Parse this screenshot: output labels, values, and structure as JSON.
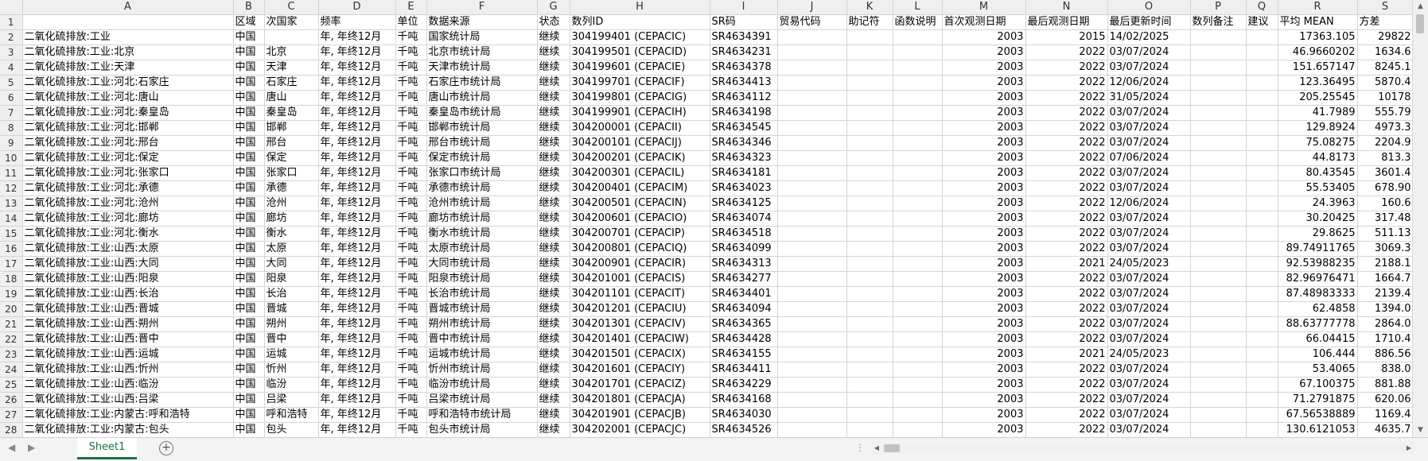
{
  "columns": [
    "A",
    "B",
    "C",
    "D",
    "E",
    "F",
    "G",
    "H",
    "I",
    "J",
    "K",
    "L",
    "M",
    "N",
    "O",
    "P",
    "Q",
    "R",
    "S"
  ],
  "header_row": {
    "rownum": "1",
    "cells": [
      "",
      "区域",
      "次国家",
      "频率",
      "单位",
      "数据来源",
      "状态",
      "数列ID",
      "SR码",
      "贸易代码",
      "助记符",
      "函数说明",
      "首次观测日期",
      "最后观测日期",
      "最后更新时间",
      "数列备注",
      "建议",
      "平均 MEAN",
      "方差"
    ]
  },
  "rows": [
    {
      "n": "2",
      "a": "二氧化硫排放:工业",
      "b": "中国",
      "c": "",
      "d": "年, 年终12月",
      "e": "千吨",
      "f": "国家统计局",
      "g": "继续",
      "h": "304199401 (CEPACIC)",
      "i": "SR4634391",
      "m": "2003",
      "nn": "2015",
      "o": "14/02/2025",
      "r": "17363.105",
      "s": "29822"
    },
    {
      "n": "3",
      "a": "二氧化硫排放:工业:北京",
      "b": "中国",
      "c": "北京",
      "d": "年, 年终12月",
      "e": "千吨",
      "f": "北京市统计局",
      "g": "继续",
      "h": "304199501 (CEPACID)",
      "i": "SR4634231",
      "m": "2003",
      "nn": "2022",
      "o": "03/07/2024",
      "r": "46.9660202",
      "s": "1634.6"
    },
    {
      "n": "4",
      "a": "二氧化硫排放:工业:天津",
      "b": "中国",
      "c": "天津",
      "d": "年, 年终12月",
      "e": "千吨",
      "f": "天津市统计局",
      "g": "继续",
      "h": "304199601 (CEPACIE)",
      "i": "SR4634378",
      "m": "2003",
      "nn": "2022",
      "o": "03/07/2024",
      "r": "151.657147",
      "s": "8245.1"
    },
    {
      "n": "5",
      "a": "二氧化硫排放:工业:河北:石家庄",
      "b": "中国",
      "c": "石家庄",
      "d": "年, 年终12月",
      "e": "千吨",
      "f": "石家庄市统计局",
      "g": "继续",
      "h": "304199701 (CEPACIF)",
      "i": "SR4634413",
      "m": "2003",
      "nn": "2022",
      "o": "12/06/2024",
      "r": "123.36495",
      "s": "5870.4"
    },
    {
      "n": "6",
      "a": "二氧化硫排放:工业:河北:唐山",
      "b": "中国",
      "c": "唐山",
      "d": "年, 年终12月",
      "e": "千吨",
      "f": "唐山市统计局",
      "g": "继续",
      "h": "304199801 (CEPACIG)",
      "i": "SR4634112",
      "m": "2003",
      "nn": "2022",
      "o": "31/05/2024",
      "r": "205.25545",
      "s": "10178"
    },
    {
      "n": "7",
      "a": "二氧化硫排放:工业:河北:秦皇岛",
      "b": "中国",
      "c": "秦皇岛",
      "d": "年, 年终12月",
      "e": "千吨",
      "f": "秦皇岛市统计局",
      "g": "继续",
      "h": "304199901 (CEPACIH)",
      "i": "SR4634198",
      "m": "2003",
      "nn": "2022",
      "o": "03/07/2024",
      "r": "41.7989",
      "s": "555.79"
    },
    {
      "n": "8",
      "a": "二氧化硫排放:工业:河北:邯郸",
      "b": "中国",
      "c": "邯郸",
      "d": "年, 年终12月",
      "e": "千吨",
      "f": "邯郸市统计局",
      "g": "继续",
      "h": "304200001 (CEPACII)",
      "i": "SR4634545",
      "m": "2003",
      "nn": "2022",
      "o": "03/07/2024",
      "r": "129.8924",
      "s": "4973.3"
    },
    {
      "n": "9",
      "a": "二氧化硫排放:工业:河北:邢台",
      "b": "中国",
      "c": "邢台",
      "d": "年, 年终12月",
      "e": "千吨",
      "f": "邢台市统计局",
      "g": "继续",
      "h": "304200101 (CEPACIJ)",
      "i": "SR4634346",
      "m": "2003",
      "nn": "2022",
      "o": "03/07/2024",
      "r": "75.08275",
      "s": "2204.9"
    },
    {
      "n": "10",
      "a": "二氧化硫排放:工业:河北:保定",
      "b": "中国",
      "c": "保定",
      "d": "年, 年终12月",
      "e": "千吨",
      "f": "保定市统计局",
      "g": "继续",
      "h": "304200201 (CEPACIK)",
      "i": "SR4634323",
      "m": "2003",
      "nn": "2022",
      "o": "07/06/2024",
      "r": "44.8173",
      "s": "813.3"
    },
    {
      "n": "11",
      "a": "二氧化硫排放:工业:河北:张家口",
      "b": "中国",
      "c": "张家口",
      "d": "年, 年终12月",
      "e": "千吨",
      "f": "张家口市统计局",
      "g": "继续",
      "h": "304200301 (CEPACIL)",
      "i": "SR4634181",
      "m": "2003",
      "nn": "2022",
      "o": "03/07/2024",
      "r": "80.43545",
      "s": "3601.4"
    },
    {
      "n": "12",
      "a": "二氧化硫排放:工业:河北:承德",
      "b": "中国",
      "c": "承德",
      "d": "年, 年终12月",
      "e": "千吨",
      "f": "承德市统计局",
      "g": "继续",
      "h": "304200401 (CEPACIM)",
      "i": "SR4634023",
      "m": "2003",
      "nn": "2022",
      "o": "03/07/2024",
      "r": "55.53405",
      "s": "678.90"
    },
    {
      "n": "13",
      "a": "二氧化硫排放:工业:河北:沧州",
      "b": "中国",
      "c": "沧州",
      "d": "年, 年终12月",
      "e": "千吨",
      "f": "沧州市统计局",
      "g": "继续",
      "h": "304200501 (CEPACIN)",
      "i": "SR4634125",
      "m": "2003",
      "nn": "2022",
      "o": "12/06/2024",
      "r": "24.3963",
      "s": "160.6"
    },
    {
      "n": "14",
      "a": "二氧化硫排放:工业:河北:廊坊",
      "b": "中国",
      "c": "廊坊",
      "d": "年, 年终12月",
      "e": "千吨",
      "f": "廊坊市统计局",
      "g": "继续",
      "h": "304200601 (CEPACIO)",
      "i": "SR4634074",
      "m": "2003",
      "nn": "2022",
      "o": "03/07/2024",
      "r": "30.20425",
      "s": "317.48"
    },
    {
      "n": "15",
      "a": "二氧化硫排放:工业:河北:衡水",
      "b": "中国",
      "c": "衡水",
      "d": "年, 年终12月",
      "e": "千吨",
      "f": "衡水市统计局",
      "g": "继续",
      "h": "304200701 (CEPACIP)",
      "i": "SR4634518",
      "m": "2003",
      "nn": "2022",
      "o": "03/07/2024",
      "r": "29.8625",
      "s": "511.13"
    },
    {
      "n": "16",
      "a": "二氧化硫排放:工业:山西:太原",
      "b": "中国",
      "c": "太原",
      "d": "年, 年终12月",
      "e": "千吨",
      "f": "太原市统计局",
      "g": "继续",
      "h": "304200801 (CEPACIQ)",
      "i": "SR4634099",
      "m": "2003",
      "nn": "2022",
      "o": "03/07/2024",
      "r": "89.74911765",
      "s": "3069.3"
    },
    {
      "n": "17",
      "a": "二氧化硫排放:工业:山西:大同",
      "b": "中国",
      "c": "大同",
      "d": "年, 年终12月",
      "e": "千吨",
      "f": "大同市统计局",
      "g": "继续",
      "h": "304200901 (CEPACIR)",
      "i": "SR4634313",
      "m": "2003",
      "nn": "2021",
      "o": "24/05/2023",
      "r": "92.53988235",
      "s": "2188.1"
    },
    {
      "n": "18",
      "a": "二氧化硫排放:工业:山西:阳泉",
      "b": "中国",
      "c": "阳泉",
      "d": "年, 年终12月",
      "e": "千吨",
      "f": "阳泉市统计局",
      "g": "继续",
      "h": "304201001 (CEPACIS)",
      "i": "SR4634277",
      "m": "2003",
      "nn": "2022",
      "o": "03/07/2024",
      "r": "82.96976471",
      "s": "1664.7"
    },
    {
      "n": "19",
      "a": "二氧化硫排放:工业:山西:长治",
      "b": "中国",
      "c": "长治",
      "d": "年, 年终12月",
      "e": "千吨",
      "f": "长治市统计局",
      "g": "继续",
      "h": "304201101 (CEPACIT)",
      "i": "SR4634401",
      "m": "2003",
      "nn": "2022",
      "o": "03/07/2024",
      "r": "87.48983333",
      "s": "2139.4"
    },
    {
      "n": "20",
      "a": "二氧化硫排放:工业:山西:晋城",
      "b": "中国",
      "c": "晋城",
      "d": "年, 年终12月",
      "e": "千吨",
      "f": "晋城市统计局",
      "g": "继续",
      "h": "304201201 (CEPACIU)",
      "i": "SR4634094",
      "m": "2003",
      "nn": "2022",
      "o": "03/07/2024",
      "r": "62.4858",
      "s": "1394.0"
    },
    {
      "n": "21",
      "a": "二氧化硫排放:工业:山西:朔州",
      "b": "中国",
      "c": "朔州",
      "d": "年, 年终12月",
      "e": "千吨",
      "f": "朔州市统计局",
      "g": "继续",
      "h": "304201301 (CEPACIV)",
      "i": "SR4634365",
      "m": "2003",
      "nn": "2022",
      "o": "03/07/2024",
      "r": "88.63777778",
      "s": "2864.0"
    },
    {
      "n": "22",
      "a": "二氧化硫排放:工业:山西:晋中",
      "b": "中国",
      "c": "晋中",
      "d": "年, 年终12月",
      "e": "千吨",
      "f": "晋中市统计局",
      "g": "继续",
      "h": "304201401 (CEPACIW)",
      "i": "SR4634428",
      "m": "2003",
      "nn": "2022",
      "o": "03/07/2024",
      "r": "66.04415",
      "s": "1710.4"
    },
    {
      "n": "23",
      "a": "二氧化硫排放:工业:山西:运城",
      "b": "中国",
      "c": "运城",
      "d": "年, 年终12月",
      "e": "千吨",
      "f": "运城市统计局",
      "g": "继续",
      "h": "304201501 (CEPACIX)",
      "i": "SR4634155",
      "m": "2003",
      "nn": "2021",
      "o": "24/05/2023",
      "r": "106.444",
      "s": "886.56"
    },
    {
      "n": "24",
      "a": "二氧化硫排放:工业:山西:忻州",
      "b": "中国",
      "c": "忻州",
      "d": "年, 年终12月",
      "e": "千吨",
      "f": "忻州市统计局",
      "g": "继续",
      "h": "304201601 (CEPACIY)",
      "i": "SR4634411",
      "m": "2003",
      "nn": "2022",
      "o": "03/07/2024",
      "r": "53.4065",
      "s": "838.0"
    },
    {
      "n": "25",
      "a": "二氧化硫排放:工业:山西:临汾",
      "b": "中国",
      "c": "临汾",
      "d": "年, 年终12月",
      "e": "千吨",
      "f": "临汾市统计局",
      "g": "继续",
      "h": "304201701 (CEPACIZ)",
      "i": "SR4634229",
      "m": "2003",
      "nn": "2022",
      "o": "03/07/2024",
      "r": "67.100375",
      "s": "881.88"
    },
    {
      "n": "26",
      "a": "二氧化硫排放:工业:山西:吕梁",
      "b": "中国",
      "c": "吕梁",
      "d": "年, 年终12月",
      "e": "千吨",
      "f": "吕梁市统计局",
      "g": "继续",
      "h": "304201801 (CEPACJA)",
      "i": "SR4634168",
      "m": "2003",
      "nn": "2022",
      "o": "03/07/2024",
      "r": "71.2791875",
      "s": "620.06"
    },
    {
      "n": "27",
      "a": "二氧化硫排放:工业:内蒙古:呼和浩特",
      "b": "中国",
      "c": "呼和浩特",
      "d": "年, 年终12月",
      "e": "千吨",
      "f": "呼和浩特市统计局",
      "g": "继续",
      "h": "304201901 (CEPACJB)",
      "i": "SR4634030",
      "m": "2003",
      "nn": "2022",
      "o": "03/07/2024",
      "r": "67.56538889",
      "s": "1169.4"
    },
    {
      "n": "28",
      "a": "二氧化硫排放:工业:内蒙古:包头",
      "b": "中国",
      "c": "包头",
      "d": "年, 年终12月",
      "e": "千吨",
      "f": "包头市统计局",
      "g": "继续",
      "h": "304202001 (CEPACJC)",
      "i": "SR4634526",
      "m": "2003",
      "nn": "2022",
      "o": "03/07/2024",
      "r": "130.6121053",
      "s": "4635.7"
    }
  ],
  "tabbar": {
    "nav_prev": "◀",
    "nav_next": "▶",
    "sheet_tab": "Sheet1",
    "add_sheet": "+",
    "options_dots": "⋮"
  },
  "scroll": {
    "up": "▲",
    "down": "▼",
    "left": "◀",
    "right": "▶"
  }
}
